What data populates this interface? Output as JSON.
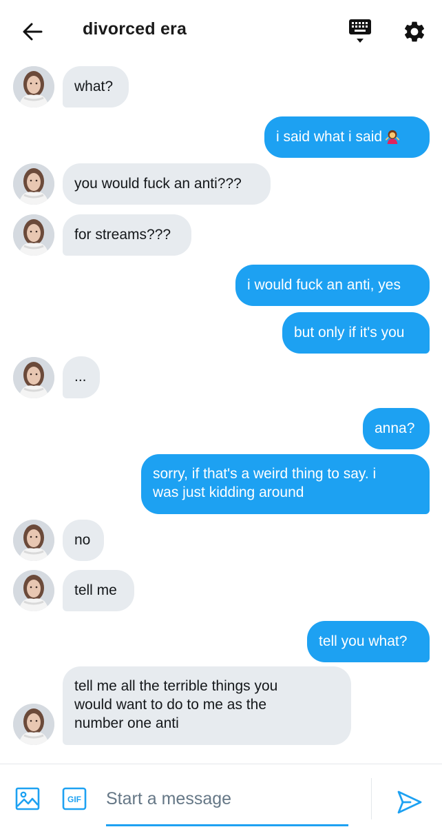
{
  "header": {
    "title": "divorced era",
    "back_icon": "arrow-left-icon",
    "keyboard_icon": "keyboard-icon",
    "settings_icon": "gear-icon"
  },
  "colors": {
    "accent": "#1da1f2",
    "incoming_bubble": "#e7ebef",
    "incoming_text": "#14171a",
    "outgoing_text": "#ffffff"
  },
  "messages": [
    {
      "dir": "in",
      "text": "what?"
    },
    {
      "dir": "out",
      "text": "i said what i said",
      "emoji": "woman-shrugging-emoji"
    },
    {
      "dir": "in",
      "text": "you would fuck an anti???"
    },
    {
      "dir": "in",
      "text": "for streams???"
    },
    {
      "dir": "out",
      "text": "i would fuck an anti, yes"
    },
    {
      "dir": "out",
      "text": "but only if it's you"
    },
    {
      "dir": "in",
      "text": "..."
    },
    {
      "dir": "out",
      "text": "anna?"
    },
    {
      "dir": "out",
      "text": "sorry, if that's a weird thing to say. i\nwas just kidding around"
    },
    {
      "dir": "in",
      "text": "no"
    },
    {
      "dir": "in",
      "text": "tell me"
    },
    {
      "dir": "out",
      "text": "tell you what?"
    },
    {
      "dir": "in",
      "text": "tell me all the terrible things you\nwould want to do to me as the\nnumber one anti"
    }
  ],
  "composer": {
    "placeholder": "Start a message",
    "value": "",
    "media_icon": "image-icon",
    "gif_label": "GIF",
    "send_icon": "send-icon"
  }
}
